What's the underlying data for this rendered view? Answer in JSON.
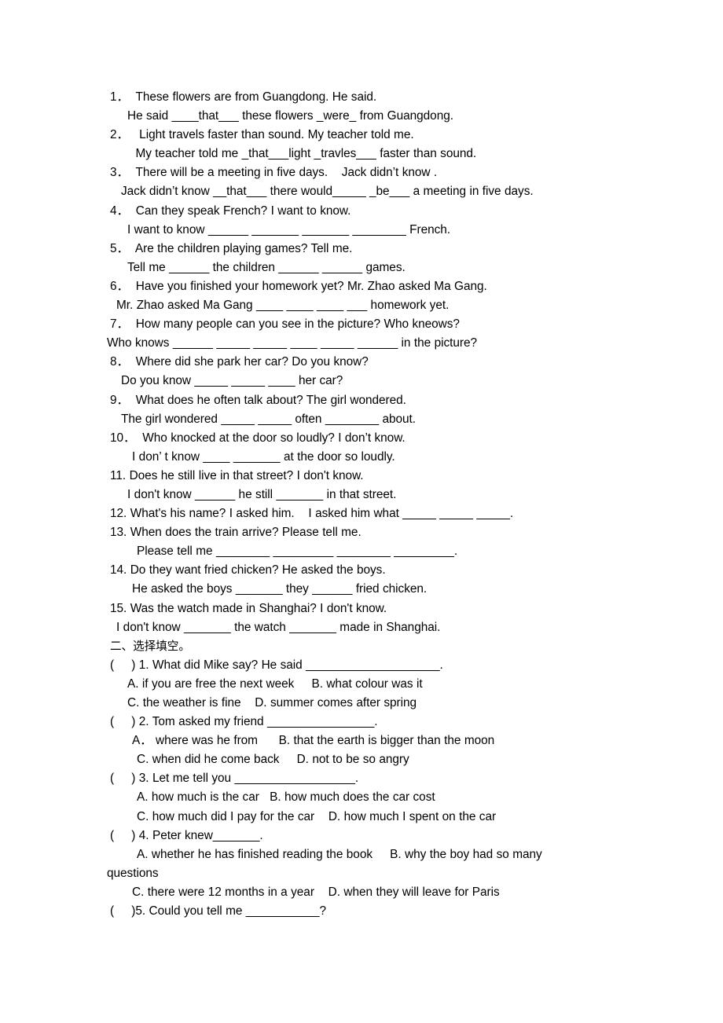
{
  "document": {
    "section_one_items": [
      {
        "number": "1．",
        "prompt": "These flowers are from Guangdong. He said.",
        "answer": "He said ____that___ these flowers _were_ from Guangdong."
      },
      {
        "number": "2．",
        "prompt": " Light travels faster than sound. My teacher told me.",
        "answer": " My teacher told me _that___light _travles___ faster than sound."
      },
      {
        "number": "3．",
        "prompt": "There will be a meeting in five days.    Jack didn’t know .",
        "answer": "Jack didn’t know __that___ there would_____ _be___ a meeting in five days."
      },
      {
        "number": "4．",
        "prompt": "Can they speak French? I want to know.",
        "answer": "I want to know ______ _______ _______ ________ French."
      },
      {
        "number": "5．",
        "prompt": "Are the children playing games? Tell me.",
        "answer": "Tell me ______ the children ______ ______ games."
      },
      {
        "number": "6．",
        "prompt": "Have you finished your homework yet? Mr. Zhao asked Ma Gang.",
        "answer": "Mr. Zhao asked Ma Gang ____ ____ ____ ___ homework yet."
      },
      {
        "number": "7．",
        "prompt": "How many people can you see in the picture? Who kneows?",
        "answer": "Who knows ______ _____ _____ ____ _____ ______ in the picture?"
      },
      {
        "number": "8．",
        "prompt": "Where did she park her car? Do you know?",
        "answer": "Do you know _____ _____ ____ her car?"
      },
      {
        "number": "9．",
        "prompt": "What does he often talk about? The girl wondered.",
        "answer": "The girl wondered _____ _____ often ________ about."
      },
      {
        "number": "10．",
        "prompt": " Who knocked at the door so loudly? I don’t know.",
        "answer": "I don’ t know ____ _______ at the door so loudly."
      },
      {
        "number": "11.",
        "prompt": "Does he still live in that street? I don't know.",
        "answer": "I don't know ______ he still _______ in that street."
      },
      {
        "number": "12.",
        "prompt": "What's his name? I asked him.    I asked him what _____ _____ _____.",
        "answer": ""
      },
      {
        "number": "13.",
        "prompt": "When does the train arrive? Please tell me.",
        "answer": "Please tell me ________ _________ ________ _________."
      },
      {
        "number": "14.",
        "prompt": "Do they want fried chicken? He asked the boys.",
        "answer": "He asked the boys _______ they ______ fried chicken."
      },
      {
        "number": "15.",
        "prompt": "Was the watch made in Shanghai? I don't know.",
        "answer": "I don't know _______ the watch _______ made in Shanghai."
      }
    ],
    "section_two_heading": "二、选择填空。",
    "section_two_items": [
      {
        "marker": "(     ) 1.",
        "stem": " What did Mike say? He said ____________________.",
        "option_lines": [
          "A. if you are free the next week     B. what colour was it",
          "C. the weather is fine    D. summer comes after spring"
        ]
      },
      {
        "marker": "(     ) 2.",
        "stem": " Tom asked my friend ________________.",
        "option_lines": [
          "A． where was he from      B. that the earth is bigger than the moon",
          "C. when did he come back     D. not to be so angry"
        ]
      },
      {
        "marker": "(     ) 3.",
        "stem": " Let me tell you __________________.",
        "option_lines": [
          "A. how much is the car   B. how much does the car cost",
          "C. how much did I pay for the car    D. how much I spent on the car"
        ]
      },
      {
        "marker": "(     ) 4.",
        "stem": " Peter knew_______.",
        "option_lines": [
          "A. whether he has finished reading the book     B. why the boy had so many",
          "questions",
          "C. there were 12 months in a year    D. when they will leave for Paris"
        ]
      },
      {
        "marker": "(     )5.",
        "stem": " Could you tell me ___________?",
        "option_lines": []
      }
    ]
  }
}
